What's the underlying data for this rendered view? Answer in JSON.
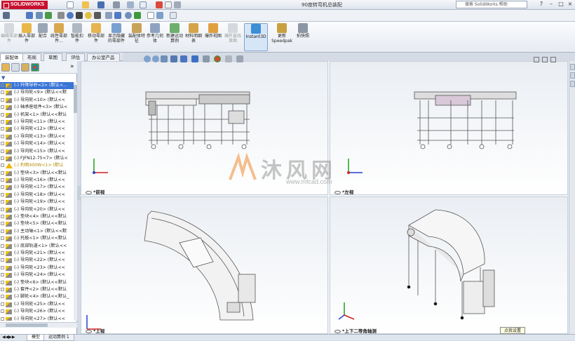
{
  "app": {
    "brand": "SOLIDWORKS",
    "document_title": "90度转弯机总装配"
  },
  "search": {
    "placeholder": "搜索 SolidWorks 帮助"
  },
  "window_controls": [
    "?",
    "–",
    "□",
    "×"
  ],
  "ribbon": {
    "buttons": [
      {
        "label": "编辑零部件",
        "disabled": true
      },
      {
        "label": "插入零部件",
        "disabled": false
      },
      {
        "label": "配合",
        "disabled": false
      },
      {
        "label": "线性零部件...",
        "disabled": false
      },
      {
        "label": "智能扣件",
        "disabled": false
      },
      {
        "label": "移动零部件",
        "disabled": false
      },
      {
        "label": "显示隐藏的零部件",
        "disabled": false
      },
      {
        "label": "装配体特征",
        "disabled": false
      },
      {
        "label": "参考几何体",
        "disabled": false
      },
      {
        "label": "新建运动算例",
        "disabled": false
      },
      {
        "label": "材料明细表",
        "disabled": false
      },
      {
        "label": "爆炸视图",
        "disabled": false
      },
      {
        "label": "爆炸直线草图",
        "disabled": true
      },
      {
        "label": "Instant3D",
        "disabled": false,
        "active": true
      },
      {
        "label": "更新Speedpak",
        "disabled": false
      },
      {
        "label": "拍快照",
        "disabled": false
      }
    ]
  },
  "command_tabs": [
    "装配体",
    "布局",
    "草图",
    "评估",
    "办公室产品"
  ],
  "tree": {
    "items": [
      {
        "text": "(-) 升降导杆<2> (默认<...",
        "selected": true
      },
      {
        "text": "(-) 导向轮<9> (默认<<默"
      },
      {
        "text": "(-) 导向轮<10> (默认<<"
      },
      {
        "text": "(-) 轴承座组件<3> (默认<"
      },
      {
        "text": "(-) 机架<1> (默认<<默认"
      },
      {
        "text": "(-) 导向轮<11> (默认<<"
      },
      {
        "text": "(-) 导向轮<12> (默认<<"
      },
      {
        "text": "(-) 导向轮<13> (默认<<"
      },
      {
        "text": "(-) 导向轮<14> (默认<<"
      },
      {
        "text": "(-) 导向轮<15> (默认<<"
      },
      {
        "text": "(-) FJFN12-75<7> (默认<"
      },
      {
        "text": "(-) 利明400W<1> (默认",
        "warn": true
      },
      {
        "text": "(-) 垫块<3> (默认<<默认"
      },
      {
        "text": "(-) 导向轮<16> (默认<<"
      },
      {
        "text": "(-) 导向轮<17> (默认<<"
      },
      {
        "text": "(-) 导向轮<18> (默认<<"
      },
      {
        "text": "(-) 导向轮<19> (默认<<"
      },
      {
        "text": "(-) 导向轮<20> (默认<<"
      },
      {
        "text": "(-) 垫块<4> (默认<<默认"
      },
      {
        "text": "(-) 垫块<5> (默认<<默认"
      },
      {
        "text": "(-) 主动轴<1> (默认<<默"
      },
      {
        "text": "(-) 托板<1> (默认<<默认"
      },
      {
        "text": "(-) 底部轨道<1> (默认<<"
      },
      {
        "text": "(-) 导向轮<21> (默认<<"
      },
      {
        "text": "(-) 导向轮<22> (默认<<"
      },
      {
        "text": "(-) 导向轮<23> (默认<<"
      },
      {
        "text": "(-) 导向轮<24> (默认<<"
      },
      {
        "text": "(-) 垫块<6> (默认<<默认"
      },
      {
        "text": "(-) 套件<2> (默认<<默认"
      },
      {
        "text": "(-) 脚轮<4> (默认<<默认_"
      },
      {
        "text": "(-) 导向轮<25> (默认<<"
      },
      {
        "text": "(-) 导向轮<26> (默认<<"
      },
      {
        "text": "(-) 导向轮<27> (默认<<"
      }
    ]
  },
  "bottom_tabs": [
    "模型",
    "运动算例 1"
  ],
  "viewports": {
    "front": "*前视",
    "left": "*左视",
    "top": "*上视",
    "iso": "*上下二等角轴测"
  },
  "watermark": {
    "text": "沐风网",
    "url": "www.mfcad.com"
  },
  "tooltip": "点我设置",
  "colors": {
    "brand_red": "#c8102e",
    "selection_blue": "#3875d7",
    "triad_x": "#d02020",
    "triad_y": "#20a020",
    "triad_z": "#2040d0"
  }
}
